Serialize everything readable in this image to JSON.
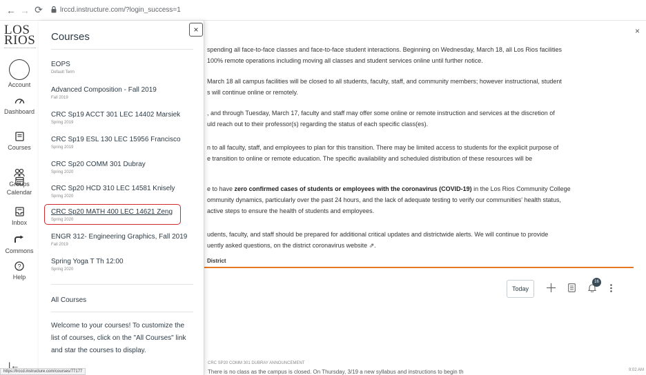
{
  "browser": {
    "url": "lrccd.instructure.com/?login_success=1"
  },
  "logo": {
    "line1": "LOS",
    "line2": "RIOS"
  },
  "global_nav": [
    {
      "key": "account",
      "label": "Account",
      "icon": "account-avatar"
    },
    {
      "key": "dashboard",
      "label": "Dashboard",
      "icon": "dashboard-icon"
    },
    {
      "key": "courses",
      "label": "Courses",
      "icon": "courses-icon"
    },
    {
      "key": "groups",
      "label": "Groups",
      "icon": "groups-icon"
    },
    {
      "key": "calendar",
      "label": "Calendar",
      "icon": "calendar-icon"
    },
    {
      "key": "inbox",
      "label": "Inbox",
      "icon": "inbox-icon"
    },
    {
      "key": "commons",
      "label": "Commons",
      "icon": "commons-icon"
    },
    {
      "key": "help",
      "label": "Help",
      "icon": "help-icon"
    }
  ],
  "tray": {
    "title": "Courses",
    "close_label": "×",
    "courses": [
      {
        "name": "EOPS",
        "term": "Default Term"
      },
      {
        "name": "Advanced Composition - Fall 2019",
        "term": "Fall 2019"
      },
      {
        "name": "CRC Sp19 ACCT 301 LEC 14402 Marsiek",
        "term": "Spring 2019"
      },
      {
        "name": "CRC Sp19 ESL 130 LEC 15956 Francisco",
        "term": "Spring 2019"
      },
      {
        "name": "CRC Sp20 COMM 301 Dubray",
        "term": "Spring 2020"
      },
      {
        "name": "CRC Sp20 HCD 310 LEC 14581 Knisely",
        "term": "Spring 2020"
      },
      {
        "name": "CRC Sp20 MATH 400 LEC 14621 Zeng",
        "term": "Spring 2020"
      },
      {
        "name": "ENGR 312- Engineering Graphics, Fall 2019",
        "term": "Fall 2019"
      },
      {
        "name": "Spring Yoga T Th 12:00",
        "term": "Spring 2020"
      }
    ],
    "all_courses": "All Courses",
    "welcome": "Welcome to your courses! To customize the list of courses, click on the \"All Courses\" link and star the courses to display."
  },
  "announcement": {
    "close_label": "×",
    "paragraphs": [
      {
        "lines": [
          "spending all face-to-face classes and face-to-face student interactions. Beginning on Wednesday, March 18, all Los Rios facilities",
          "100% remote operations including moving all classes and student services online until further notice."
        ]
      },
      {
        "lines": [
          "March 18 all campus facilities will be closed to all students, faculty, staff, and community members; however instructional, student",
          "s will continue online or remotely."
        ]
      },
      {
        "lines": [
          ", and through Tuesday, March 17, faculty and staff may offer some online or remote instruction and services at the discretion of",
          "uld reach out to their professor(s) regarding the status of each specific class(es)."
        ]
      },
      {
        "lines": [
          "n to all faculty, staff, and employees to plan for this transition. There may be limited access to students for the explicit purpose of",
          "e transition to online or remote education. The specific availability and scheduled distribution of these resources will be"
        ]
      },
      {
        "pre": "e to have ",
        "bold": "zero confirmed cases of students or employees with the coronavirus (COVID-19)",
        "post": " in the Los Rios Community College",
        "lines": [
          "ommunity dynamics, particularly over the past 24 hours, and the lack of adequate testing to verify our communities' health status,",
          "active steps to ensure the health of students and employees."
        ]
      },
      {
        "lines": [
          "udents, faculty, and staff should be prepared for additional critical updates and districtwide alerts. We will continue to provide",
          "uently asked questions, on the district coronavirus website ⇗."
        ]
      }
    ],
    "signature": "District"
  },
  "toolbar": {
    "today_label": "Today",
    "notification_count": "16"
  },
  "feed": {
    "label": "CRC SP20 COMM 301 DUBRAY ANNOUNCEMENT",
    "time": "9:02 AM",
    "preview": "There is no class as the campus is closed. On Thursday, 3/19 a new syllabus and instructions to begin th"
  },
  "status_bar": {
    "url": "https://lrccd.instructure.com/courses/77177"
  },
  "colors": {
    "highlight": "#d0272d",
    "accent": "#e87722"
  }
}
